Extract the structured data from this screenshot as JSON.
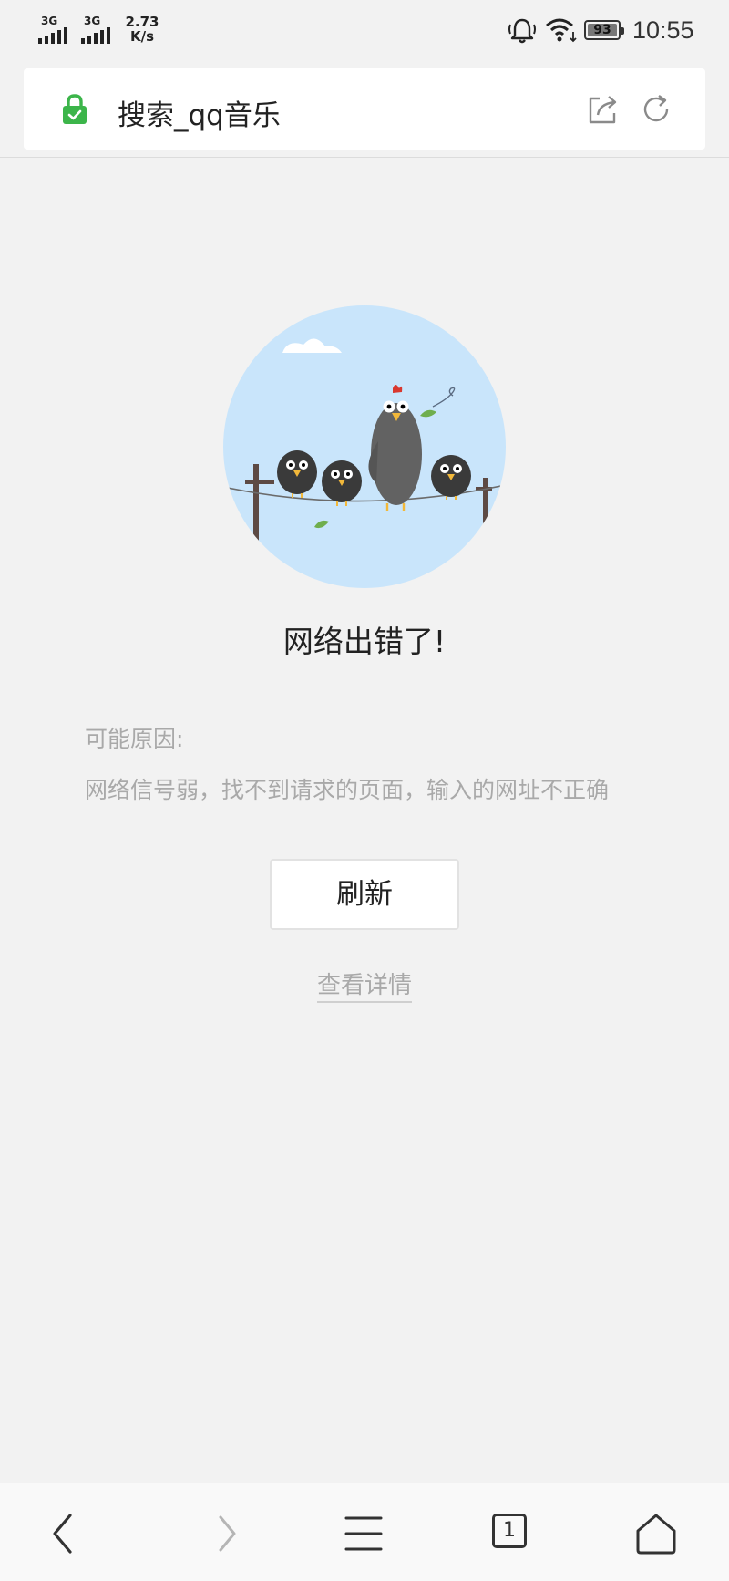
{
  "status_bar": {
    "signal_1_label": "3G",
    "signal_2_label": "3G",
    "net_speed_value": "2.73",
    "net_speed_unit": "K/s",
    "battery": "93",
    "time": "10:55",
    "icons": [
      "signal-icon",
      "signal-icon",
      "bell-icon",
      "wifi-icon",
      "battery-icon"
    ]
  },
  "address_bar": {
    "title": "搜索_qq音乐",
    "icons": [
      "lock-icon",
      "share-icon",
      "refresh-icon"
    ],
    "lock_color": "#3cb54a"
  },
  "error": {
    "title": "网络出错了!",
    "reasons_label": "可能原因:",
    "reasons_text": "网络信号弱，找不到请求的页面，输入的网址不正确",
    "refresh_label": "刷新",
    "details_label": "查看详情"
  },
  "bottom_nav": {
    "tab_count": "1",
    "icons": [
      "back-icon",
      "forward-icon",
      "menu-icon",
      "tabs-icon",
      "home-icon"
    ]
  }
}
